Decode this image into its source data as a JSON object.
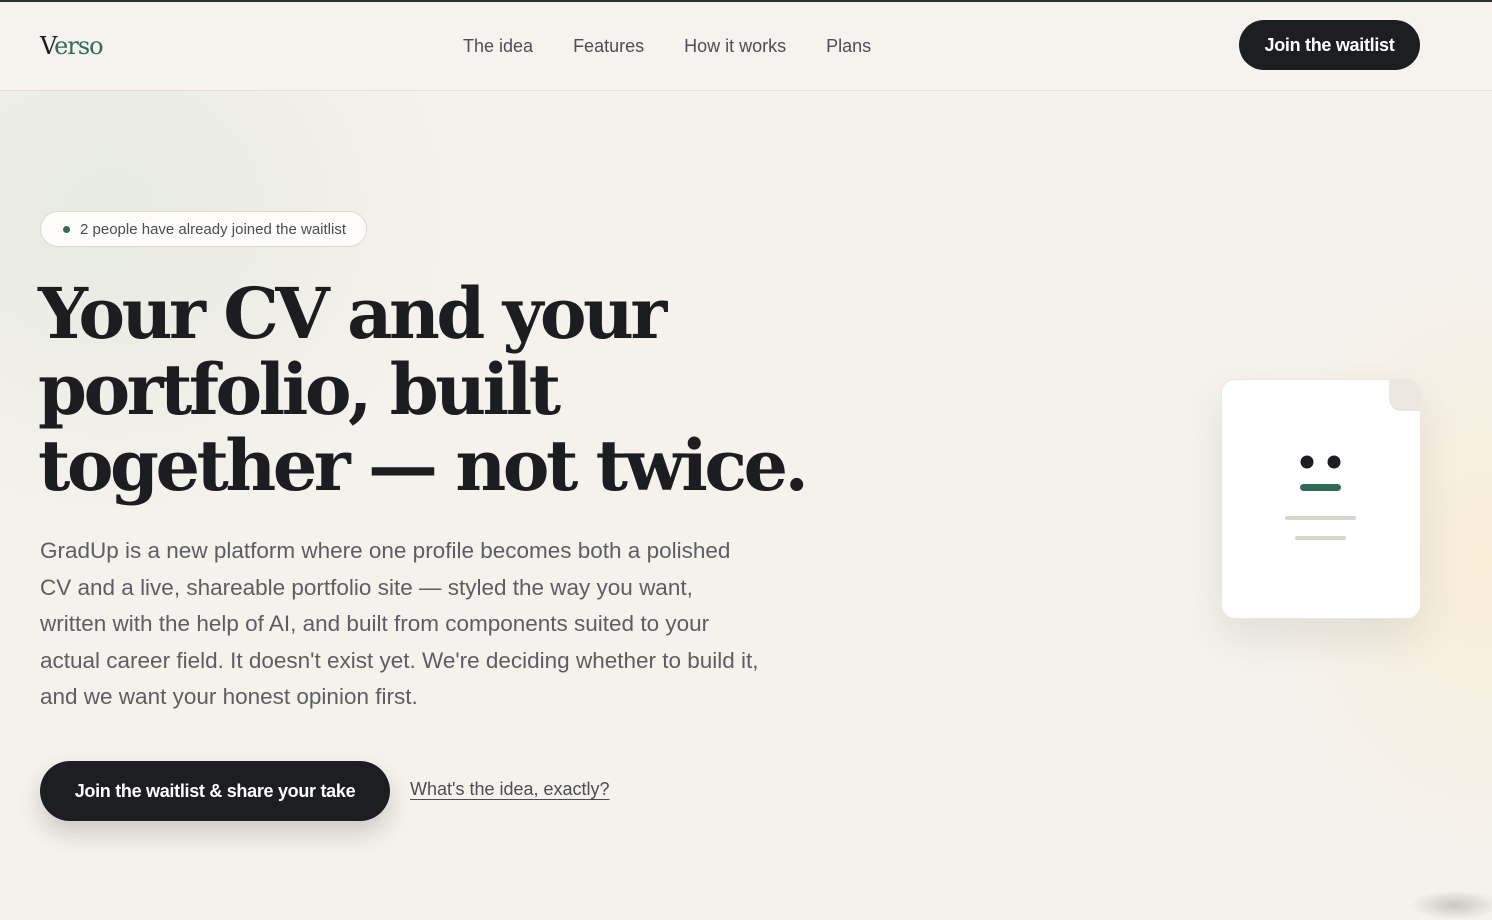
{
  "brand": {
    "first_letter": "V",
    "rest": "erso"
  },
  "nav": {
    "links": [
      "The idea",
      "Features",
      "How it works",
      "Plans"
    ],
    "cta_label": "Join the waitlist"
  },
  "hero": {
    "badge_text": "2 people have already joined the waitlist",
    "title_lines": [
      "Your CV and your",
      "portfolio, built",
      "together — not twice."
    ],
    "description": "GradUp is a new platform where one profile becomes both a polished CV and a live, shareable portfolio site — styled the way you want, written with the help of AI, and built from components suited to your actual career field. It doesn't exist yet. We're deciding whether to build it, and we want your honest opinion first.",
    "primary_cta": "Join the waitlist & share your take",
    "secondary_cta": "What's the idea, exactly?"
  },
  "colors": {
    "background": "#f5f2ec",
    "ink": "#1c1e22",
    "accent_green": "#2f6b55",
    "muted_text": "#5b5e63"
  },
  "illustration": {
    "icon": "document-face-icon"
  }
}
